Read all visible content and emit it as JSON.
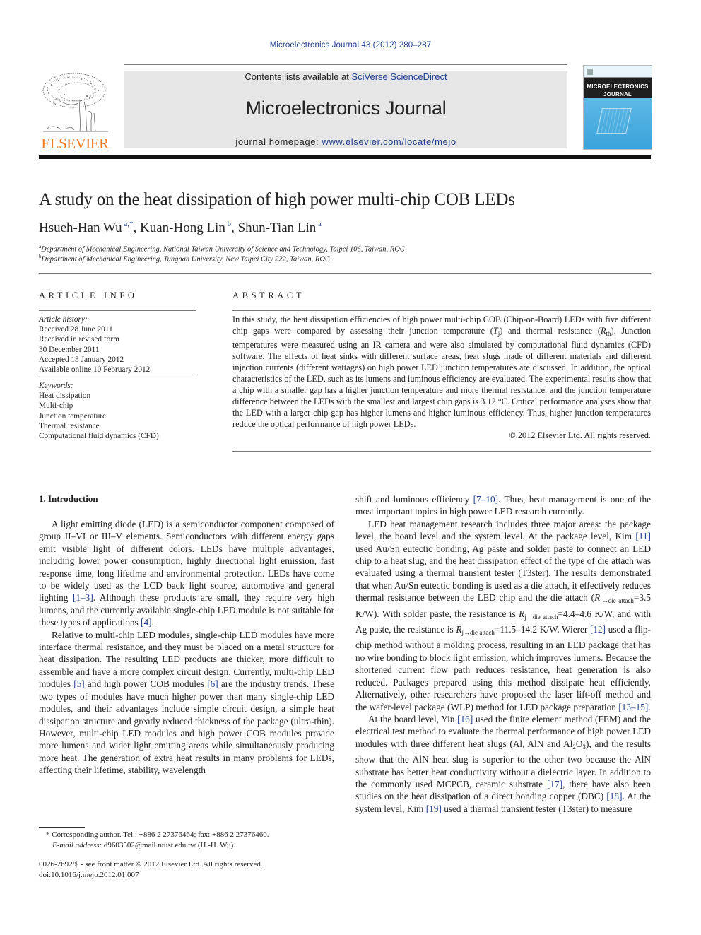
{
  "header": {
    "citation": "Microelectronics Journal 43 (2012) 280–287",
    "contents_prefix": "Contents lists available at ",
    "contents_link": "SciVerse ScienceDirect",
    "journal_title": "Microelectronics Journal",
    "homepage_prefix": "journal homepage: ",
    "homepage_link": "www.elsevier.com/locate/mejo",
    "publisher_logo_text": "ELSEVIER",
    "cover_title_line1": "MICROELECTRONICS",
    "cover_title_line2": "JOURNAL"
  },
  "article": {
    "title": "A study on the heat dissipation of high power multi-chip COB LEDs",
    "authors": [
      {
        "name": "Hsueh-Han Wu",
        "marks": "a,*",
        "sep": ", "
      },
      {
        "name": "Kuan-Hong Lin",
        "marks": "b",
        "sep": ", "
      },
      {
        "name": "Shun-Tian Lin",
        "marks": "a",
        "sep": ""
      }
    ],
    "affiliations": [
      {
        "mark": "a",
        "text": "Department of Mechanical Engineering, National Taiwan University of Science and Technology, Taipei 106, Taiwan, ROC"
      },
      {
        "mark": "b",
        "text": "Department of Mechanical Engineering, Tungnan University, New Taipei City 222, Taiwan, ROC"
      }
    ]
  },
  "article_info": {
    "heading": "ARTICLE INFO",
    "history_label": "Article history:",
    "history": [
      "Received 28 June 2011",
      "Received in revised form",
      "30 December 2011",
      "Accepted 13 January 2012",
      "Available online 10 February 2012"
    ],
    "keywords_label": "Keywords:",
    "keywords": [
      "Heat dissipation",
      "Multi-chip",
      "Junction temperature",
      "Thermal resistance",
      "Computational fluid dynamics (CFD)"
    ]
  },
  "abstract": {
    "heading": "ABSTRACT",
    "part1": "In this study, the heat dissipation efficiencies of high power multi-chip COB (Chip-on-Board) LEDs with five different chip gaps were compared by assessing their junction temperature (",
    "tj_sym": "T",
    "tj_sub": "j",
    "part2": ") and thermal resistance (",
    "rth_sym": "R",
    "rth_sub": "th",
    "part3": "). Junction temperatures were measured using an IR camera and were also simulated by computational fluid dynamics (CFD) software. The effects of heat sinks with different surface areas, heat slugs made of different materials and different injection currents (different wattages) on high power LED junction temperatures are discussed. In addition, the optical characteristics of the LED, such as its lumens and luminous efficiency are evaluated. The experimental results show that a chip with a smaller gap has a higher junction temperature and more thermal resistance, and the junction temperature difference between the LEDs with the smallest and largest chip gaps is 3.12 °C. Optical performance analyses show that the LED with a larger chip gap has higher lumens and higher luminous efficiency. Thus, higher junction temperatures reduce the optical performance of high power LEDs.",
    "copyright": "© 2012 Elsevier Ltd. All rights reserved."
  },
  "intro": {
    "heading": "1.  Introduction",
    "p1_a": "A light emitting diode (LED) is a semiconductor component composed of group II–VI or III–V elements. Semiconductors with different energy gaps emit visible light of different colors. LEDs have multiple advantages, including lower power consumption, highly directional light emission, fast response time, long lifetime and environmental protection. LEDs have come to be widely used as the LCD back light source, automotive and general lighting ",
    "ref_1_3": "[1–3]",
    "p1_b": ". Although these products are small, they require very high lumens, and the currently available single-chip LED module is not suitable for these types of applications ",
    "ref_4": "[4]",
    "p1_c": ".",
    "p2_a": "Relative to multi-chip LED modules, single-chip LED modules have more interface thermal resistance, and they must be placed on a metal structure for heat dissipation. The resulting LED products are thicker, more difficult to assemble and have a more complex circuit design. Currently, multi-chip LED modules ",
    "ref_5": "[5]",
    "p2_b": " and high power COB modules ",
    "ref_6": "[6]",
    "p2_c": " are the industry trends. These two types of modules have much higher power than many single-chip LED modules, and their advantages include simple circuit design, a simple heat dissipation structure and greatly reduced thickness of the package (ultra-thin). However, multi-chip LED modules and high power COB modules provide more lumens and wider light emitting areas while simultaneously producing more heat. The generation of extra heat results in many problems for LEDs, affecting their lifetime, stability, wavelength",
    "r_p1_a": "shift and luminous efficiency ",
    "ref_7_10": "[7–10]",
    "r_p1_b": ". Thus, heat management is one of the most important topics in high power LED research currently.",
    "r_p2_a": "LED heat management research includes three major areas: the package level, the board level and the system level. At the package level, Kim ",
    "ref_11": "[11]",
    "r_p2_b": " used Au/Sn eutectic bonding, Ag paste and solder paste to connect an LED chip to a heat slug, and the heat dissipation effect of the type of die attach was evaluated using a thermal transient tester (T3ster). The results demonstrated that when Au/Sn eutectic bonding is used as a die attach, it effectively reduces thermal resistance between the LED chip and the die attach (",
    "r_sym": "R",
    "r_sub": "j→die attach",
    "r_p2_c": "=3.5 K/W). With solder paste, the resistance is ",
    "r_p2_d": "=4.4–4.6 K/W, and with Ag paste, the resistance is ",
    "r_p2_e": "=11.5–14.2 K/W. Wierer ",
    "ref_12": "[12]",
    "r_p2_f": " used a flip-chip method without a molding process, resulting in an LED package that has no wire bonding to block light emission, which improves lumens. Because the shortened current flow path reduces resistance, heat generation is also reduced. Packages prepared using this method dissipate heat efficiently. Alternatively, other researchers have proposed the laser lift-off method and the wafer-level package (WLP) method for LED package preparation ",
    "ref_13_15": "[13–15]",
    "r_p2_g": ".",
    "r_p3_a": "At the board level, Yin ",
    "ref_16": "[16]",
    "r_p3_b": " used the finite element method (FEM) and the electrical test method to evaluate the thermal performance of high power LED modules with three different heat slugs (Al, AlN and Al",
    "al_sub1": "2",
    "al_o": "O",
    "al_sub2": "3",
    "r_p3_c": "), and the results show that the AlN heat slug is superior to the other two because the AlN substrate has better heat conductivity without a dielectric layer. In addition to the commonly used MCPCB, ceramic substrate ",
    "ref_17": "[17]",
    "r_p3_d": ", there have also been studies on the heat dissipation of a direct bonding copper (DBC) ",
    "ref_18": "[18]",
    "r_p3_e": ". At the system level, Kim ",
    "ref_19": "[19]",
    "r_p3_f": " used a thermal transient tester (T3ster) to measure"
  },
  "footnotes": {
    "corresponding": "* Corresponding author. Tel.: +886 2 27376464; fax: +886 2 27376460.",
    "email_label": "E-mail address:",
    "email_value": " d9603502@mail.ntust.edu.tw (H.-H. Wu).",
    "front_matter": "0026-2692/$ - see front matter © 2012 Elsevier Ltd. All rights reserved.",
    "doi": "doi:10.1016/j.mejo.2012.01.007"
  },
  "colors": {
    "link": "#1f3f8f",
    "elsevier_orange": "#f47a20",
    "header_band": "#e6e6e6"
  }
}
